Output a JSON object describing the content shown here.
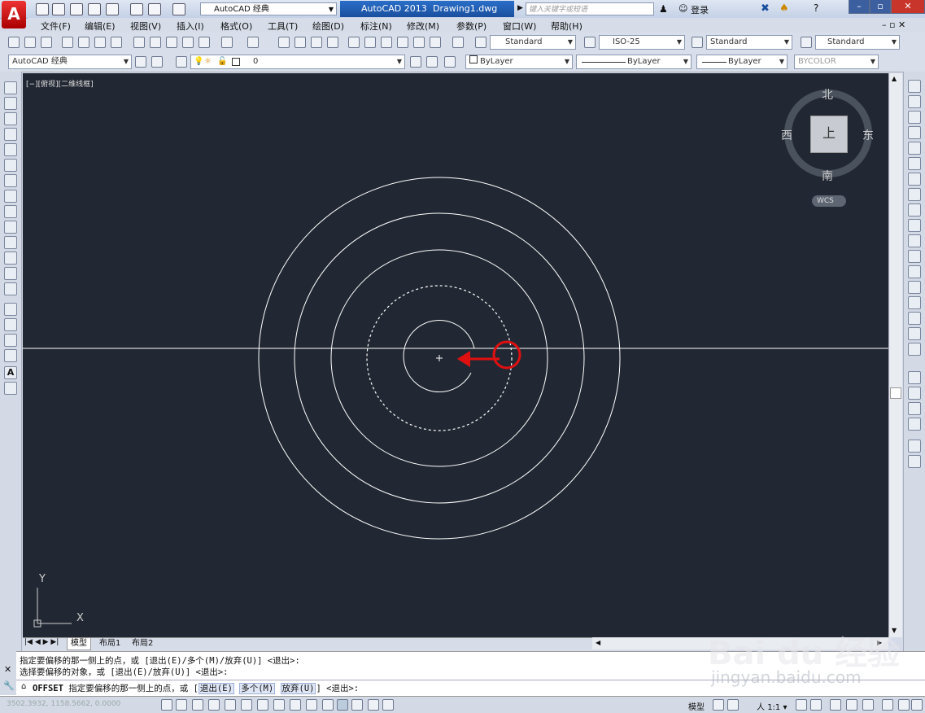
{
  "titlebar": {
    "workspace": "AutoCAD 经典",
    "app_title": "AutoCAD 2013",
    "file_name": "Drawing1.dwg",
    "search_placeholder": "键入关键字或短语",
    "login": "登录"
  },
  "menu": [
    "文件(F)",
    "编辑(E)",
    "视图(V)",
    "插入(I)",
    "格式(O)",
    "工具(T)",
    "绘图(D)",
    "标注(N)",
    "修改(M)",
    "参数(P)",
    "窗口(W)",
    "帮助(H)"
  ],
  "toolbar1": {
    "text_style": "Standard",
    "dim_style": "ISO-25",
    "table_style": "Standard",
    "mleader_style": "Standard"
  },
  "toolbar2": {
    "workspace": "AutoCAD 经典",
    "layer": "0",
    "color": "ByLayer",
    "linetype": "ByLayer",
    "lineweight": "ByLayer",
    "plotstyle": "BYCOLOR"
  },
  "viewport": {
    "label": "[−][俯视][二维线框]",
    "viewcube": {
      "north": "北",
      "south": "南",
      "east": "东",
      "west": "西",
      "top": "上",
      "wcs": "WCS"
    },
    "ucs": {
      "x": "X",
      "y": "Y"
    }
  },
  "tabs": [
    "模型",
    "布局1",
    "布局2"
  ],
  "command": {
    "history": [
      "指定要偏移的那一侧上的点，或 [退出(E)/多个(M)/放弃(U)] <退出>:",
      "选择要偏移的对象，或 [退出(E)/放弃(U)] <退出>:"
    ],
    "prompt_cmd": "OFFSET",
    "prompt_text": "指定要偏移的那一侧上的点，或 [",
    "opt_exit": "退出(E)",
    "opt_multi": "多个(M)",
    "opt_undo": "放弃(U)",
    "prompt_end": "] <退出>:"
  },
  "status": {
    "coords": "3502.3932, 1158.5662, 0.0000",
    "model": "模型",
    "scale": "1:1"
  },
  "colors": {
    "canvas": "#222833",
    "annotation": "#e01010",
    "titlebar_accent": "#1a4f9e"
  },
  "watermark": {
    "brand": "Bai du 经验",
    "url": "jingyan.baidu.com"
  }
}
